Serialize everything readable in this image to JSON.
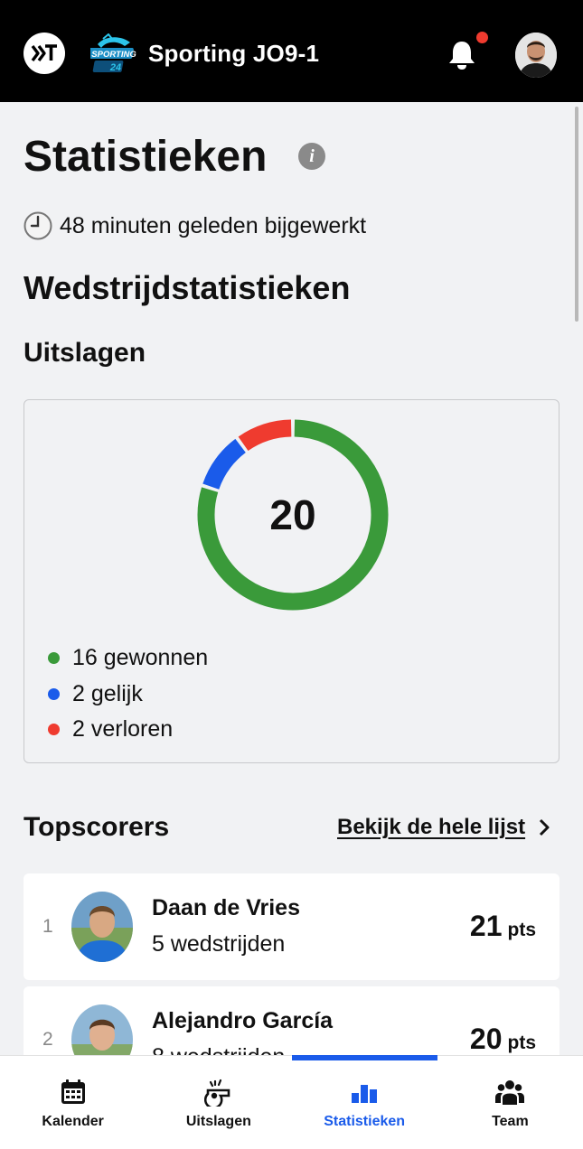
{
  "header": {
    "team_name": "Sporting JO9-1",
    "club_badge_text_1": "SPORTING",
    "club_badge_text_2": "24",
    "notification_dot_color": "#ef3b2f"
  },
  "page": {
    "title": "Statistieken",
    "updated": "48 minuten geleden bijgewerkt",
    "section_title": "Wedstrijdstatistieken",
    "results_title": "Uitslagen"
  },
  "results": {
    "total": "20",
    "legend": [
      {
        "label": "16 gewonnen",
        "value": 16,
        "color": "#3a9a3a"
      },
      {
        "label": "2 gelijk",
        "value": 2,
        "color": "#1a5bea"
      },
      {
        "label": "2 verloren",
        "value": 2,
        "color": "#ef3b2f"
      }
    ]
  },
  "chart_data": {
    "type": "pie",
    "categories": [
      "gewonnen",
      "gelijk",
      "verloren"
    ],
    "values": [
      16,
      2,
      2
    ],
    "colors": [
      "#3a9a3a",
      "#1a5bea",
      "#ef3b2f"
    ],
    "title": "Uitslagen",
    "center_label": "20"
  },
  "topscorers": {
    "title": "Topscorers",
    "view_all": "Bekijk de hele lijst",
    "players": [
      {
        "rank": "1",
        "name": "Daan de Vries",
        "matches": "5 wedstrijden",
        "points": "21",
        "unit": "pts"
      },
      {
        "rank": "2",
        "name": "Alejandro García",
        "matches": "8 wedstrijden",
        "points": "20",
        "unit": "pts"
      }
    ]
  },
  "nav": {
    "items": [
      {
        "label": "Kalender",
        "icon": "calendar-icon"
      },
      {
        "label": "Uitslagen",
        "icon": "whistle-icon"
      },
      {
        "label": "Statistieken",
        "icon": "bar-chart-icon",
        "active": true
      },
      {
        "label": "Team",
        "icon": "team-icon"
      }
    ],
    "accent": "#1a5bea"
  }
}
